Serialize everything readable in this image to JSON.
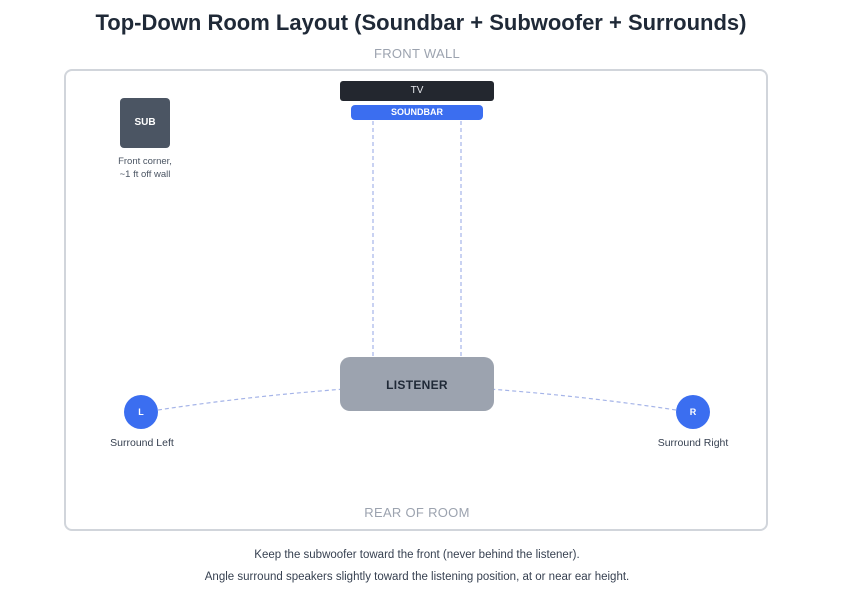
{
  "title": "Top-Down Room Layout (Soundbar + Subwoofer + Surrounds)",
  "front_wall": "FRONT WALL",
  "rear": "REAR OF ROOM",
  "tv": "TV",
  "soundbar": "SOUNDBAR",
  "subwoofer": {
    "label": "SUB",
    "note_line1": "Front corner,",
    "note_line2": "~1 ft off wall"
  },
  "listener": "LISTENER",
  "surround_left": {
    "badge": "L",
    "label": "Surround Left"
  },
  "surround_right": {
    "badge": "R",
    "label": "Surround Right"
  },
  "notes": [
    "Keep the subwoofer toward the front (never behind the listener).",
    "Angle surround speakers slightly toward the listening position, at or near ear height."
  ],
  "colors": {
    "soundbar": "#3b6ef0",
    "speaker": "#3b6ef0",
    "tv": "#23272f",
    "subwoofer": "#4b5563",
    "listener": "#9ca3af",
    "guide_line": "#a5b4e8"
  }
}
